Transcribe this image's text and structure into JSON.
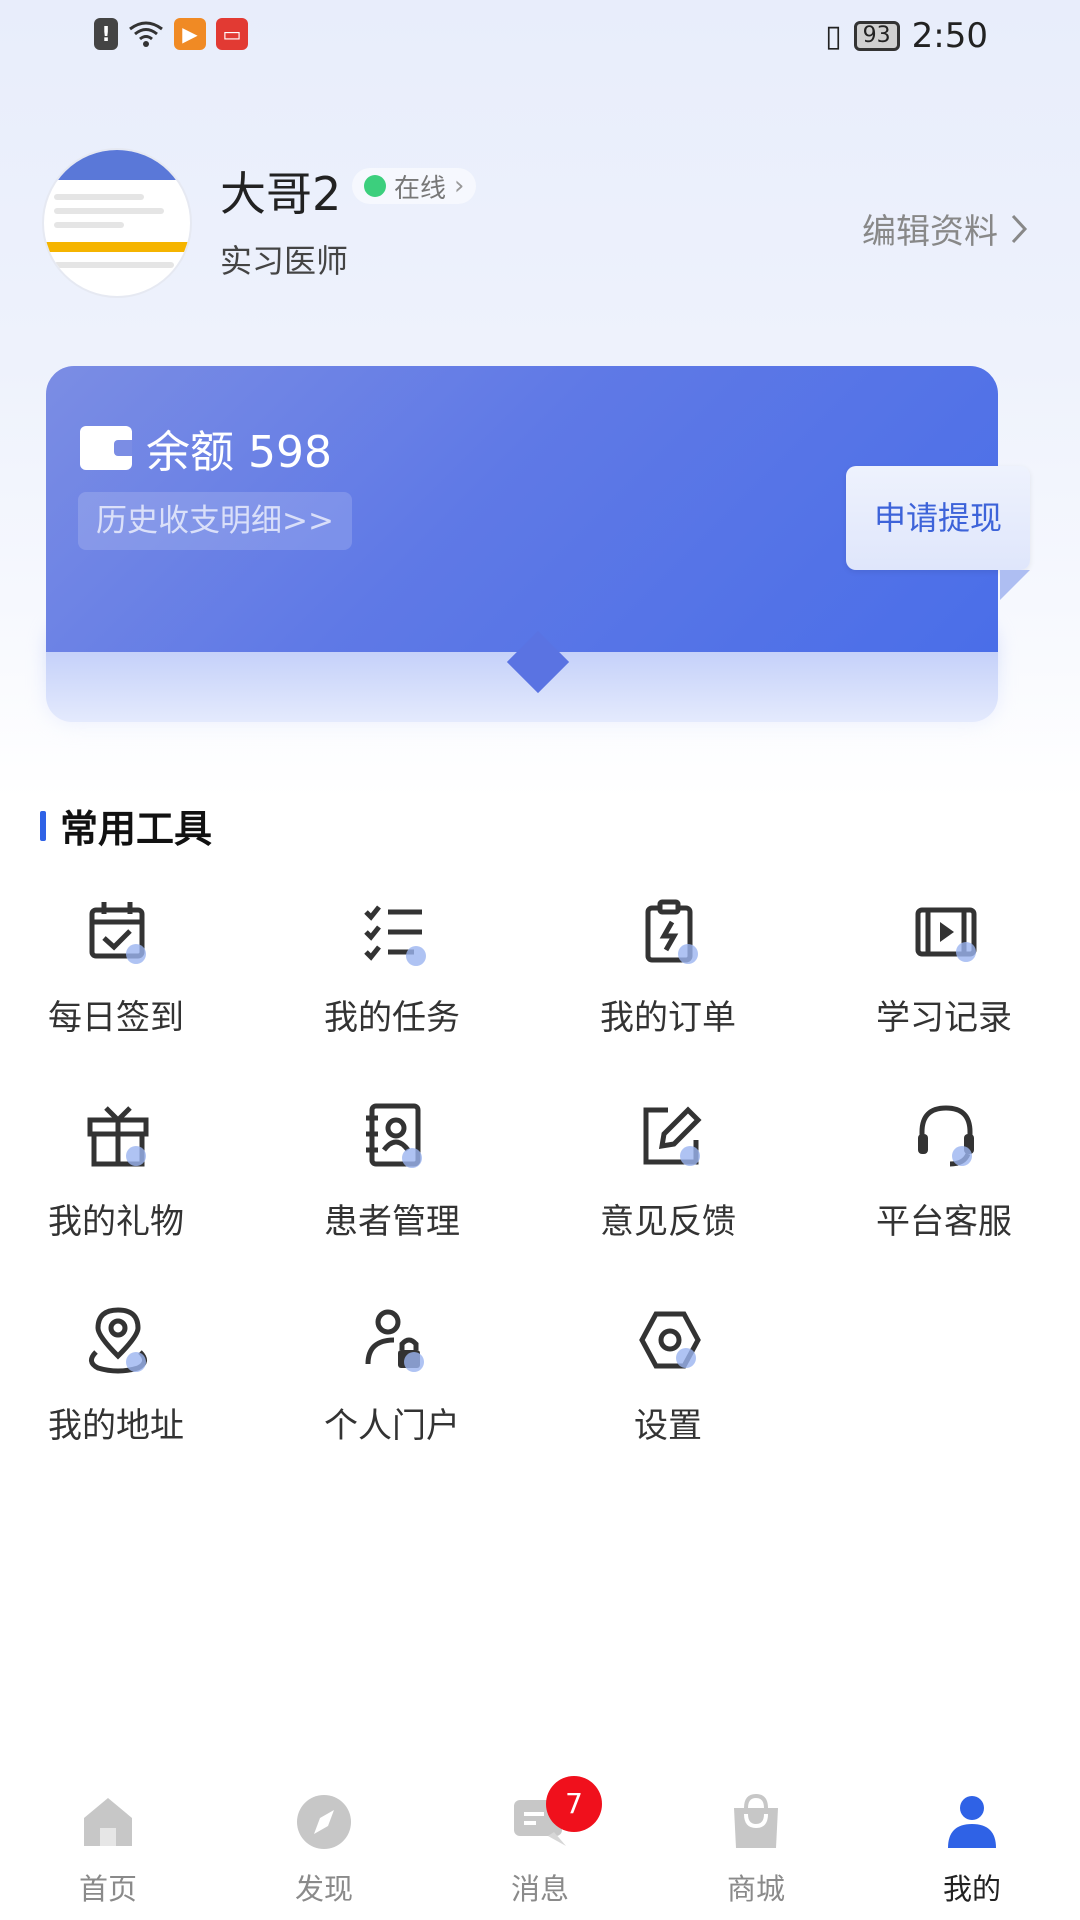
{
  "status_bar": {
    "time": "2:50",
    "battery": "93",
    "icons": [
      "alert-icon",
      "wifi-icon",
      "video-app-icon",
      "tv-app-icon",
      "vibrate-icon"
    ]
  },
  "profile": {
    "name": "大哥2",
    "status": "在线",
    "title": "实习医师",
    "edit_label": "编辑资料"
  },
  "wallet": {
    "balance_label": "余额 598",
    "history_label": "历史收支明细>>",
    "withdraw_label": "申请提现"
  },
  "tools": {
    "section_title": "常用工具",
    "items": [
      {
        "label": "每日签到",
        "icon": "calendar-check-icon"
      },
      {
        "label": "我的任务",
        "icon": "task-list-icon"
      },
      {
        "label": "我的订单",
        "icon": "clipboard-order-icon"
      },
      {
        "label": "学习记录",
        "icon": "video-play-icon"
      },
      {
        "label": "我的礼物",
        "icon": "gift-icon"
      },
      {
        "label": "患者管理",
        "icon": "patient-contact-icon"
      },
      {
        "label": "意见反馈",
        "icon": "edit-feedback-icon"
      },
      {
        "label": "平台客服",
        "icon": "headset-icon"
      },
      {
        "label": "我的地址",
        "icon": "location-pin-icon"
      },
      {
        "label": "个人门户",
        "icon": "user-lock-icon"
      },
      {
        "label": "设置",
        "icon": "settings-hexagon-icon"
      }
    ]
  },
  "tabbar": {
    "items": [
      {
        "label": "首页",
        "icon": "home-icon"
      },
      {
        "label": "发现",
        "icon": "compass-icon"
      },
      {
        "label": "消息",
        "icon": "message-icon"
      },
      {
        "label": "商城",
        "icon": "shopping-bag-icon"
      },
      {
        "label": "我的",
        "icon": "user-icon"
      }
    ],
    "active": "我的",
    "message_badge": "7"
  },
  "colors": {
    "accent": "#2f62e6",
    "card": "#5f79e6",
    "online": "#3ccf7d",
    "badge": "#f0101c"
  }
}
